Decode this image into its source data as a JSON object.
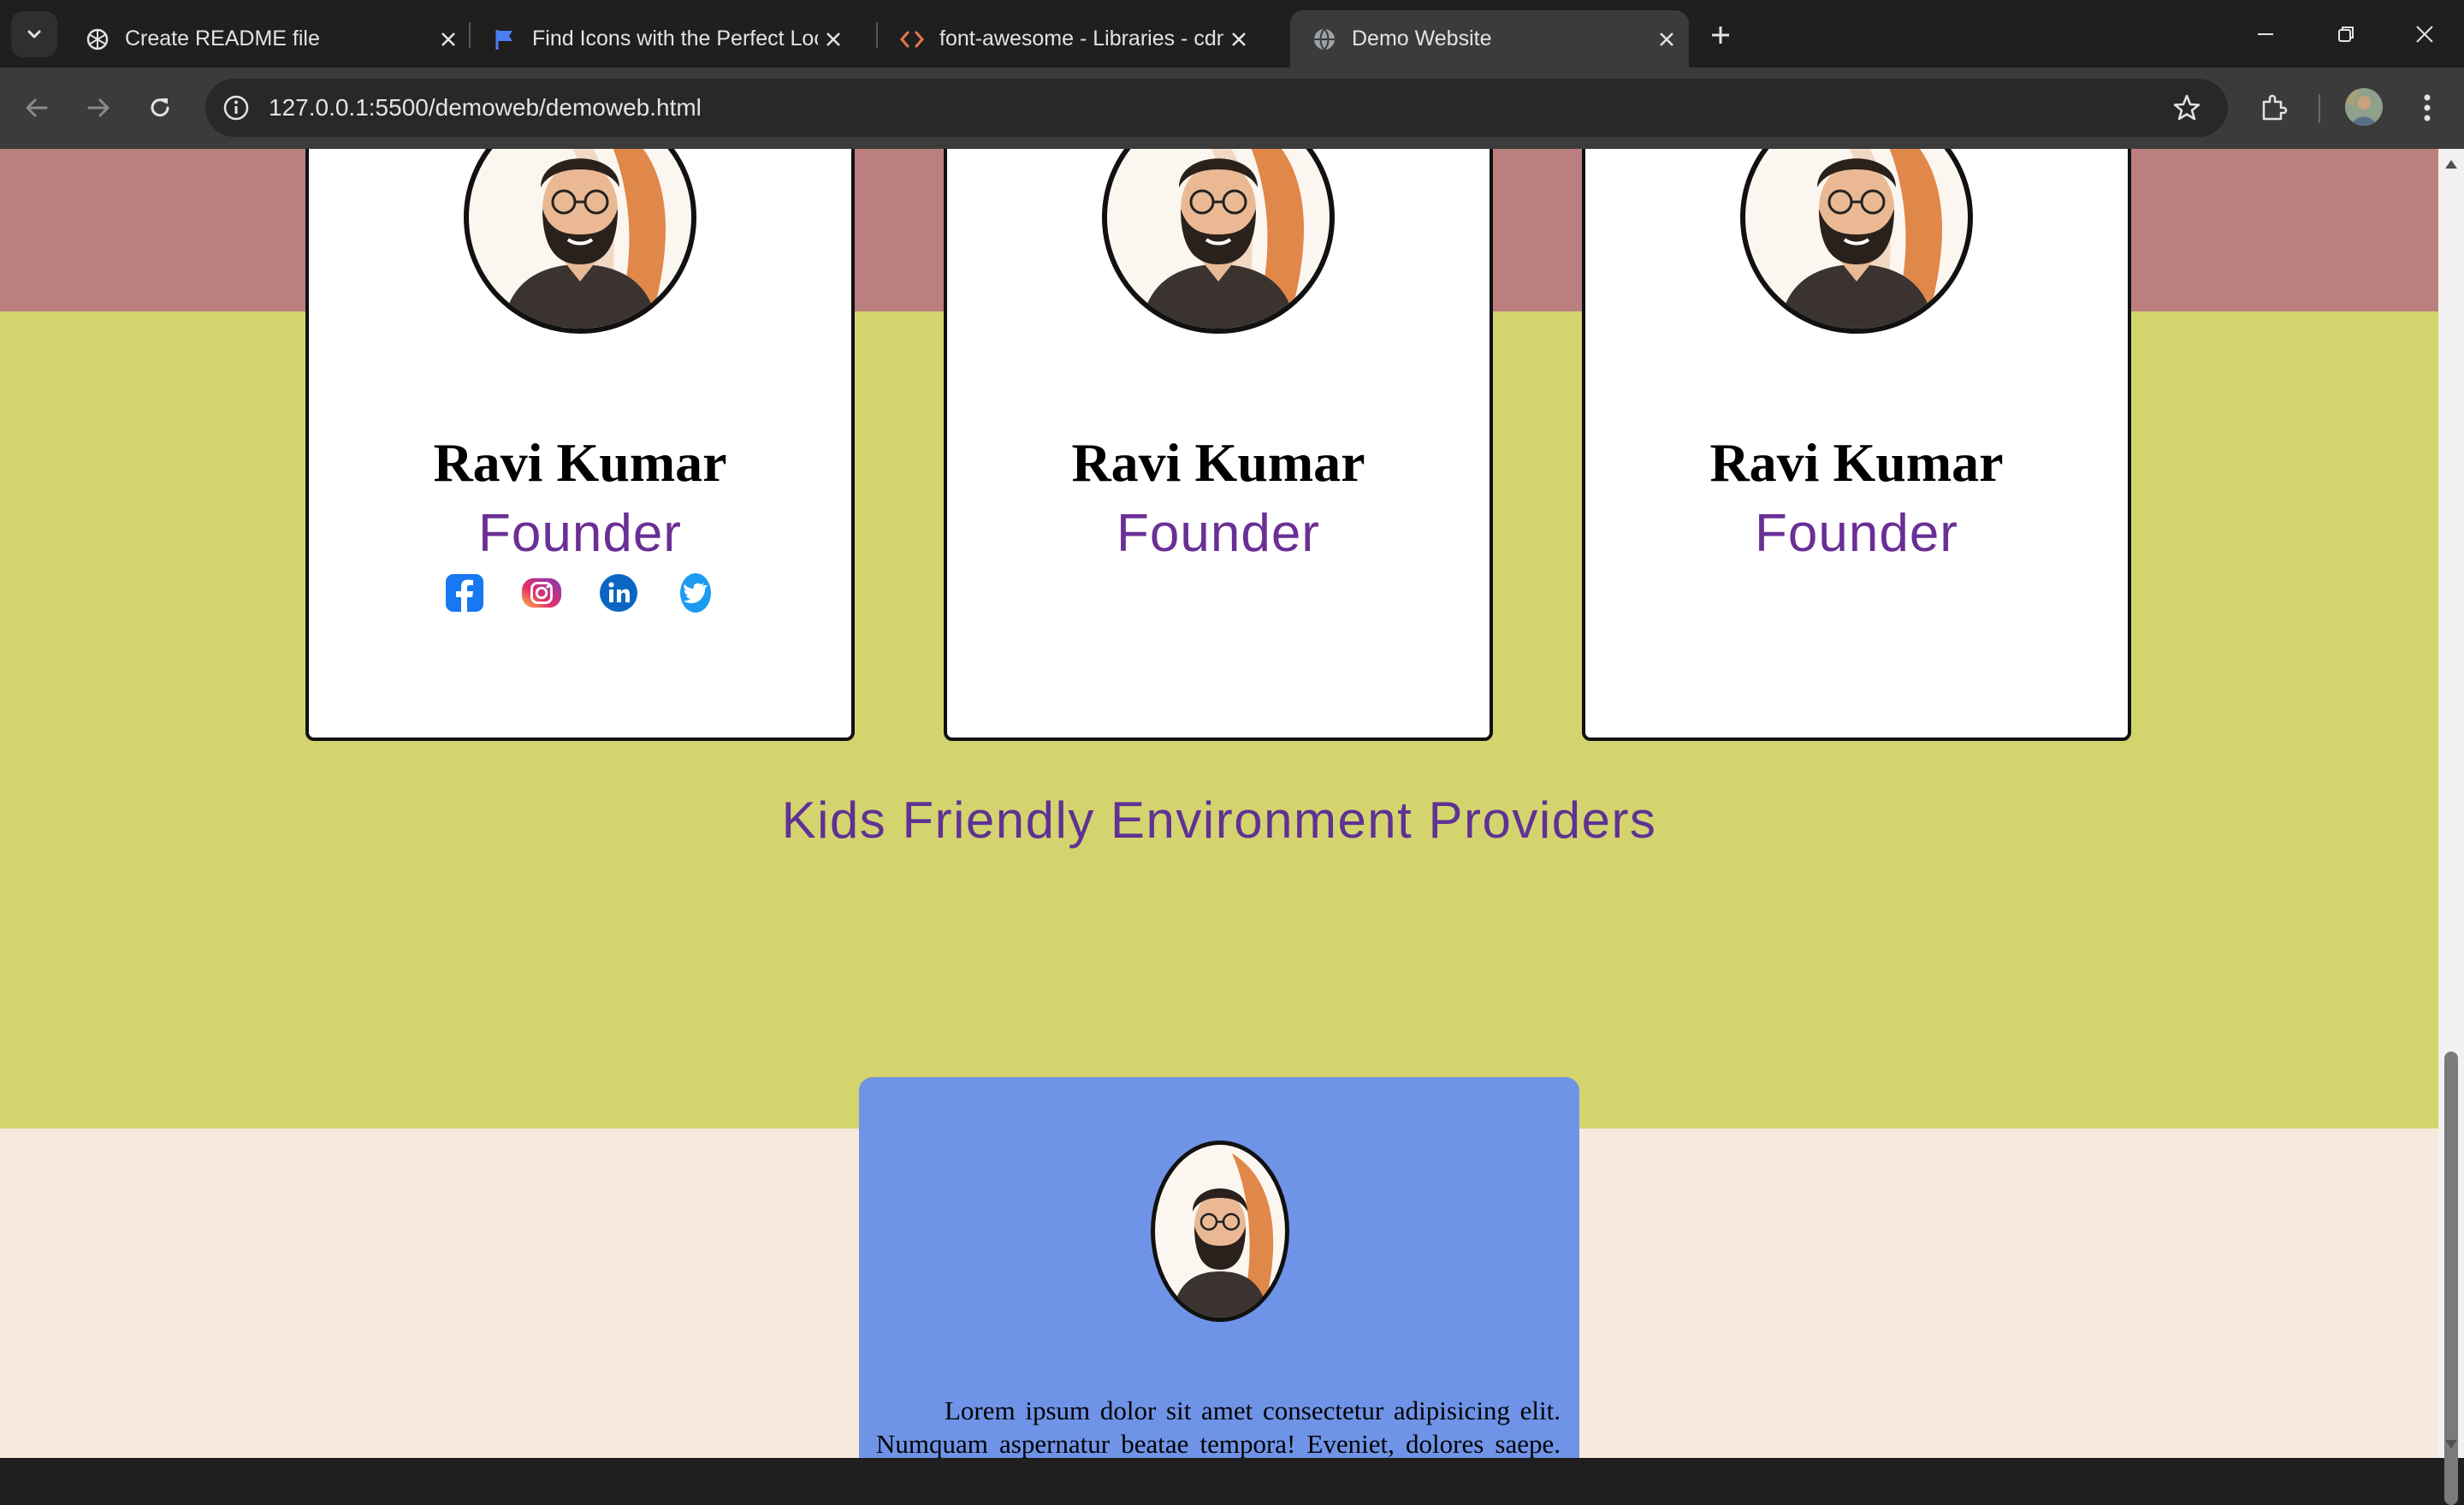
{
  "browser": {
    "tabs": [
      {
        "title": "Create README file",
        "icon": "openai-icon",
        "active": false
      },
      {
        "title": "Find Icons with the Perfect Look",
        "icon": "flag-icon",
        "active": false
      },
      {
        "title": "font-awesome - Libraries - cdnjs",
        "icon": "code-icon",
        "active": false
      },
      {
        "title": "Demo Website",
        "icon": "globe-icon",
        "active": true
      }
    ],
    "url": "127.0.0.1:5500/demoweb/demoweb.html"
  },
  "team": [
    {
      "name": "Ravi Kumar",
      "role": "Founder",
      "socials": [
        "facebook-icon",
        "instagram-icon",
        "linkedin-icon",
        "twitter-icon"
      ]
    },
    {
      "name": "Ravi Kumar",
      "role": "Founder"
    },
    {
      "name": "Ravi Kumar",
      "role": "Founder"
    }
  ],
  "section": {
    "heading": "Kids Friendly Environment Providers"
  },
  "feature": {
    "text": "Lorem ipsum dolor sit amet consectetur adipisicing elit. Numquam aspernatur beatae tempora! Eveniet, dolores saepe. Ex totam inventore cumque dolorem."
  },
  "colors": {
    "band_top": "#ba7f7e",
    "band_green": "#d4d46f",
    "page_bg": "#f5eadb",
    "feature_card": "#6f93e6",
    "role_text": "#6a2f95",
    "heading_text": "#5f3293"
  }
}
